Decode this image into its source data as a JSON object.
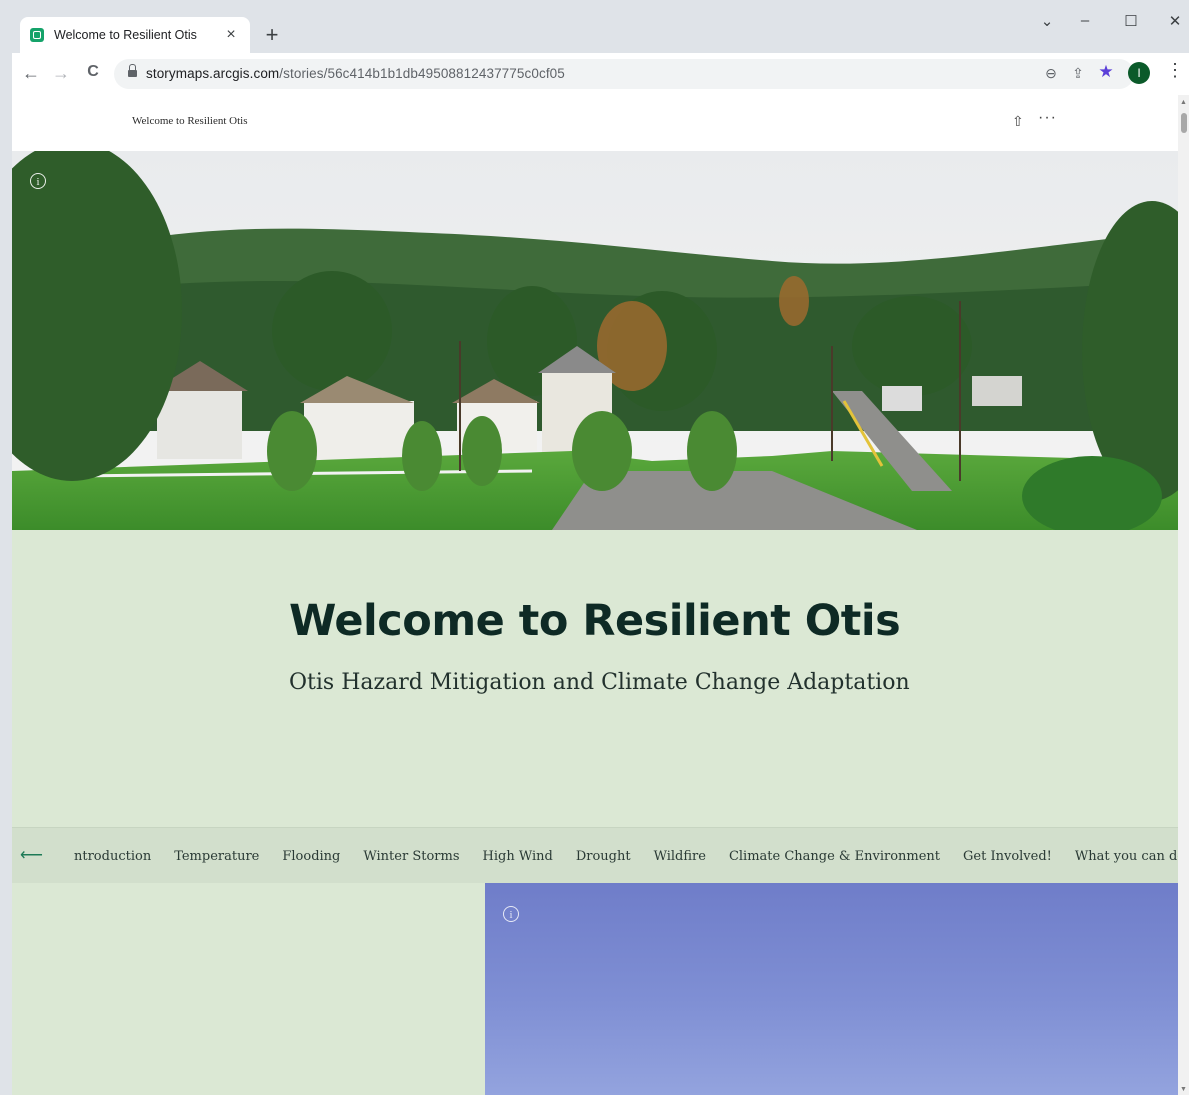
{
  "browser": {
    "tab_title": "Welcome to Resilient Otis",
    "tab_close": "×",
    "new_tab": "+",
    "url_host": "storymaps.arcgis.com",
    "url_path": "/stories/56c414b1b1db49508812437775c0cf05",
    "profile_initial": "I",
    "window_controls": {
      "dropdown": "⌄",
      "minimize": "–",
      "maximize": "☐",
      "close": "✕"
    },
    "nav": {
      "back": "←",
      "forward": "→",
      "reload": "C"
    },
    "omnibox_icons": {
      "zoom": "⊖",
      "share": "⇪",
      "bookmark": "★"
    },
    "menu": "⋮"
  },
  "story": {
    "header_title": "Welcome to Resilient Otis",
    "share_icon": "⇧",
    "more_icon": "···",
    "title": "Welcome to Resilient Otis",
    "subtitle": "Otis Hazard Mitigation and Climate Change Adaptation",
    "info_glyph": "i",
    "nav_back": "⟵",
    "nav_items": [
      "ntroduction",
      "Temperature",
      "Flooding",
      "Winter Storms",
      "High Wind",
      "Drought",
      "Wildfire",
      "Climate Change & Environment",
      "Get Involved!",
      "What you can do at home"
    ]
  },
  "colors": {
    "tab_strip": "#dfe3e8",
    "panel_green": "#dbe8d4",
    "title_text": "#0e2a25",
    "accent_green": "#1d7a56",
    "sky_blue": "#7f8fd4"
  }
}
